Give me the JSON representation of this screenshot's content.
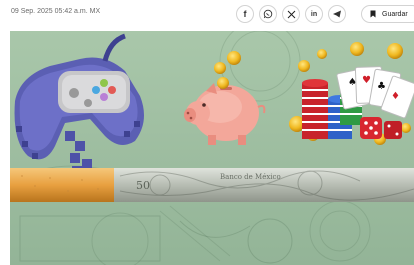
{
  "article": {
    "timestamp": "09 Sep. 2025 05:42 a.m. MX"
  },
  "share": {
    "buttons": [
      {
        "name": "facebook-button",
        "icon": "facebook-icon",
        "glyph": "f"
      },
      {
        "name": "whatsapp-button",
        "icon": "whatsapp-icon",
        "glyph": "w"
      },
      {
        "name": "x-button",
        "icon": "x-icon",
        "glyph": "𝕏"
      },
      {
        "name": "linkedin-button",
        "icon": "linkedin-icon",
        "glyph": "in"
      },
      {
        "name": "telegram-button",
        "icon": "telegram-icon",
        "glyph": "t"
      }
    ],
    "save_label": "Guardar",
    "save_icon": "bookmark-icon"
  },
  "hero": {
    "image_description_icons": [
      "game-controller",
      "piggy-bank",
      "gold-coins",
      "poker-chips",
      "playing-cards",
      "dice",
      "cigarette",
      "banknote"
    ],
    "banknote_text": "Banco de México"
  },
  "colors": {
    "background": "#a3c1a6",
    "accent_gold": "#e8b51a",
    "piggy": "#f3a79a"
  }
}
